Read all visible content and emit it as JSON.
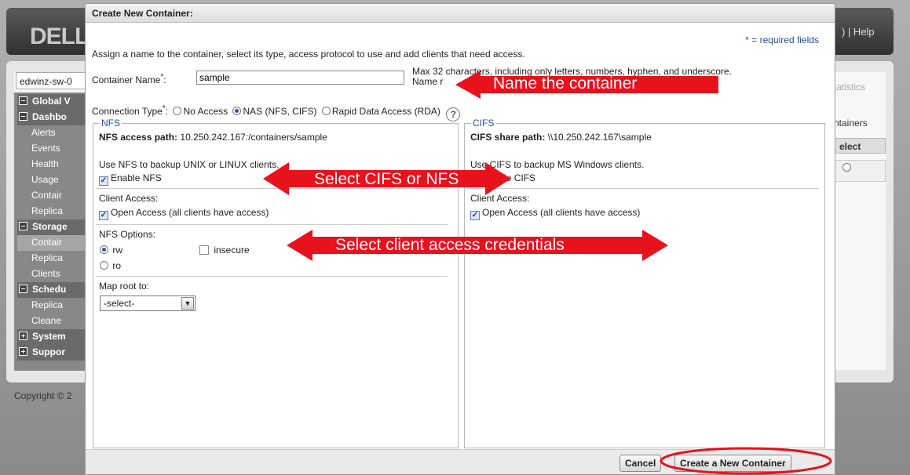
{
  "header": {
    "logo": "DELL",
    "links": ") | Help"
  },
  "system_select": {
    "value": "edwinz-sw-0"
  },
  "tree": [
    {
      "label": "Global V",
      "kind": "group",
      "toggle": "minus"
    },
    {
      "label": "Dashbo",
      "kind": "group",
      "toggle": "minus"
    },
    {
      "label": "Alerts",
      "kind": "child"
    },
    {
      "label": "Events",
      "kind": "child"
    },
    {
      "label": "Health",
      "kind": "child"
    },
    {
      "label": "Usage",
      "kind": "child"
    },
    {
      "label": "Contair",
      "kind": "child"
    },
    {
      "label": "Replica",
      "kind": "child"
    },
    {
      "label": "Storage",
      "kind": "group",
      "toggle": "minus"
    },
    {
      "label": "Contair",
      "kind": "child",
      "selected": true
    },
    {
      "label": "Replica",
      "kind": "child"
    },
    {
      "label": "Clients",
      "kind": "child"
    },
    {
      "label": "Schedu",
      "kind": "group",
      "toggle": "minus"
    },
    {
      "label": "Replica",
      "kind": "child"
    },
    {
      "label": "Cleane",
      "kind": "child"
    },
    {
      "label": "System",
      "kind": "group",
      "toggle": "plus"
    },
    {
      "label": "Suppor",
      "kind": "group",
      "toggle": "plus"
    }
  ],
  "copyright": "Copyright © 2",
  "right_panel": {
    "statistics": "tatistics",
    "containers": "ntainers",
    "select": "elect"
  },
  "dialog": {
    "title": "Create New Container:",
    "required_note": "* = required fields",
    "intro": "Assign a name to the container, select its type, access protocol to use and add clients that need access.",
    "container_name_label": "Container Name",
    "container_name_value": "sample",
    "name_hint_1": "Max 32 characters, including only letters, numbers, hyphen, and underscore.",
    "name_hint_2": "Name r",
    "connection_type_label": "Connection Type",
    "connection_options": [
      {
        "label": "No Access",
        "selected": false
      },
      {
        "label": "NAS (NFS, CIFS)",
        "selected": true
      },
      {
        "label": "Rapid Data Access (RDA)",
        "selected": false
      }
    ],
    "help_symbol": "?",
    "nfs": {
      "legend": "NFS",
      "path_label": "NFS access path:",
      "path_value": "10.250.242.167:/containers/sample",
      "use_text": "Use NFS to backup UNIX or LINUX clients.",
      "enable_label": "Enable NFS",
      "enable_checked": true,
      "client_access_label": "Client Access:",
      "open_access_label": "Open Access (all clients have access)",
      "open_access_checked": true,
      "options_label": "NFS Options:",
      "opt_rw": "rw",
      "opt_ro": "ro",
      "opt_insecure": "insecure",
      "map_root_label": "Map root to:",
      "map_root_value": "-select-"
    },
    "cifs": {
      "legend": "CIFS",
      "path_label": "CIFS share path:",
      "path_value": "\\\\10.250.242.167\\sample",
      "use_text": "Use CIFS to backup MS Windows clients.",
      "enable_label": "Enable CIFS",
      "enable_checked": true,
      "client_access_label": "Client Access:",
      "open_access_label": "Open Access (all clients have access)",
      "open_access_checked": true
    },
    "cancel_label": "Cancel",
    "create_label": "Create a New Container"
  },
  "annotations": {
    "name_the_container": "Name the container",
    "select_cifs_or_nfs": "Select CIFS or NFS",
    "select_client_access": "Select client access credentials",
    "arrow_color": "#e8121c"
  }
}
